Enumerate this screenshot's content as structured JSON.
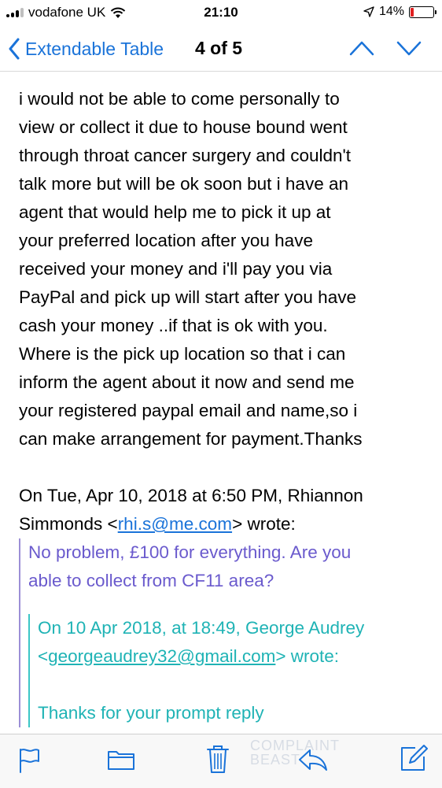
{
  "status_bar": {
    "carrier": "vodafone UK",
    "time": "21:10",
    "battery": "14%",
    "battery_level": 0.14
  },
  "nav": {
    "back_label": "Extendable Table",
    "counter": "4 of 5"
  },
  "message": {
    "lines": [
      "i would not be able to come personally to",
      "view or collect it due to house bound went",
      "through throat cancer surgery and couldn't",
      "talk more but will be ok soon  but i have an",
      "agent that would help me to pick it up at",
      "your preferred location after you have",
      "received your money and i'll pay you via",
      "PayPal and pick up will start after you have",
      "cash your money ..if that is ok with you.",
      "Where is the pick up location so that i can",
      "inform the agent about it now and send me",
      "your registered paypal email and name,so i",
      "can make arrangement for payment.Thanks"
    ],
    "attribution": {
      "line1": "On Tue, Apr 10, 2018 at 6:50 PM, Rhiannon",
      "line2_prefix": "Simmonds <",
      "email": "rhi.s@me.com",
      "line2_suffix": "> wrote:"
    },
    "quote1": {
      "lines": [
        "No problem, £100 for everything. Are you",
        "able to collect from CF11 area?"
      ]
    },
    "quote2": {
      "attribution_line1": "On 10 Apr 2018, at 18:49, George Audrey",
      "attribution_prefix": "<",
      "email": "georgeaudrey32@gmail.com",
      "attribution_suffix": "> wrote:",
      "text": "Thanks for your prompt reply"
    }
  },
  "toolbar": {
    "icons": [
      "flag-icon",
      "folder-icon",
      "trash-icon",
      "reply-icon",
      "compose-icon"
    ]
  },
  "watermark": {
    "line1": "COMPLAINT",
    "line2": "BEAST"
  },
  "colors": {
    "accent": "#1a73d9",
    "quote1": "#6a5acd",
    "quote2": "#1fb3b5",
    "battery_low": "#e02020"
  }
}
